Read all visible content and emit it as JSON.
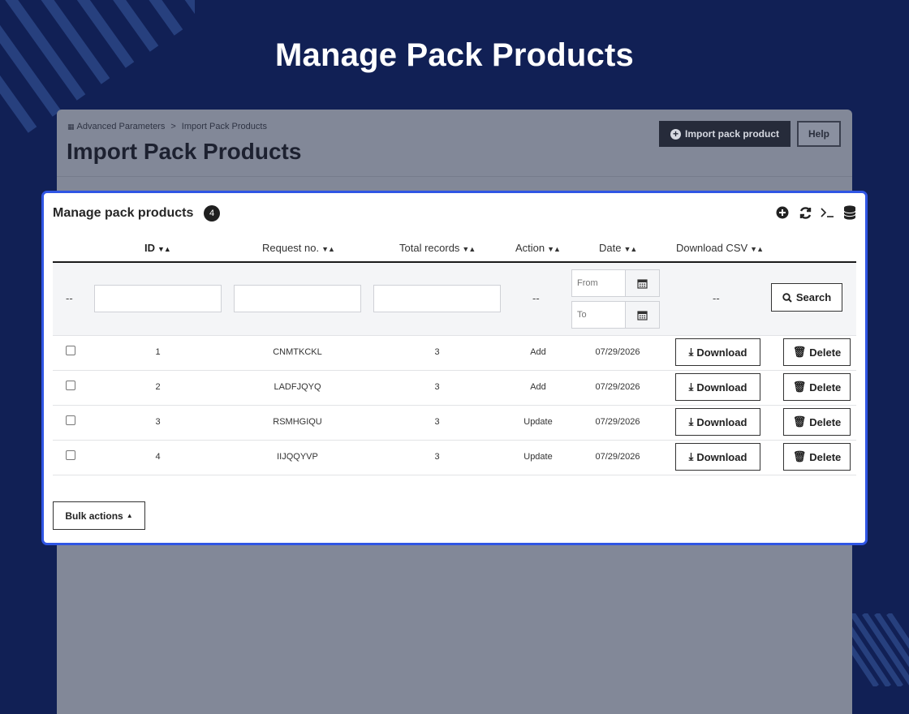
{
  "hero": {
    "title": "Manage Pack Products"
  },
  "backdrop": {
    "breadcrumb": [
      "Advanced Parameters",
      ">",
      "Import Pack Products"
    ],
    "title": "Import Pack Products",
    "import_button": "Import pack product",
    "help_button": "Help"
  },
  "panel": {
    "title": "Manage pack products",
    "count": "4",
    "tools": [
      "add-icon",
      "refresh-icon",
      "terminal-icon",
      "database-icon"
    ],
    "columns": {
      "id": "ID",
      "request_no": "Request no.",
      "total_records": "Total records",
      "action": "Action",
      "date": "Date",
      "download_csv": "Download CSV"
    },
    "filters": {
      "empty_marker": "--",
      "from_placeholder": "From",
      "to_placeholder": "To",
      "search_label": "Search"
    },
    "rows": [
      {
        "id": "1",
        "request_no": "CNMTKCKL",
        "total_records": "3",
        "action": "Add",
        "date": "07/29/2026"
      },
      {
        "id": "2",
        "request_no": "LADFJQYQ",
        "total_records": "3",
        "action": "Add",
        "date": "07/29/2026"
      },
      {
        "id": "3",
        "request_no": "RSMHGIQU",
        "total_records": "3",
        "action": "Update",
        "date": "07/29/2026"
      },
      {
        "id": "4",
        "request_no": "IIJQQYVP",
        "total_records": "3",
        "action": "Update",
        "date": "07/29/2026"
      }
    ],
    "download_label": "Download",
    "delete_label": "Delete",
    "bulk_actions_label": "Bulk actions"
  },
  "colors": {
    "background": "#112055",
    "accent": "#2f55e4",
    "overlay": "#828898"
  }
}
